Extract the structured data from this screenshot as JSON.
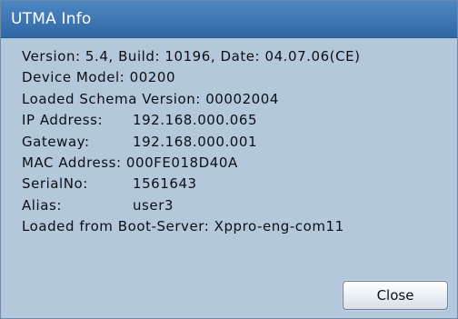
{
  "dialog": {
    "title": "UTMA Info",
    "close_label": "Close"
  },
  "info": {
    "version_line": "Version: 5.4, Build: 10196, Date: 04.07.06(CE)",
    "device_model": "Device Model: 00200",
    "schema_version": "Loaded Schema Version: 00002004",
    "ip_label": "IP Address:",
    "ip_value": "192.168.000.065",
    "gateway_label": "Gateway:",
    "gateway_value": "192.168.000.001",
    "mac_line": "MAC Address: 000FE018D40A",
    "serial_label": "SerialNo:",
    "serial_value": "1561643",
    "alias_label": "Alias:",
    "alias_value": "user3",
    "boot_server_line": "Loaded from Boot-Server: Xppro-eng-com11"
  }
}
